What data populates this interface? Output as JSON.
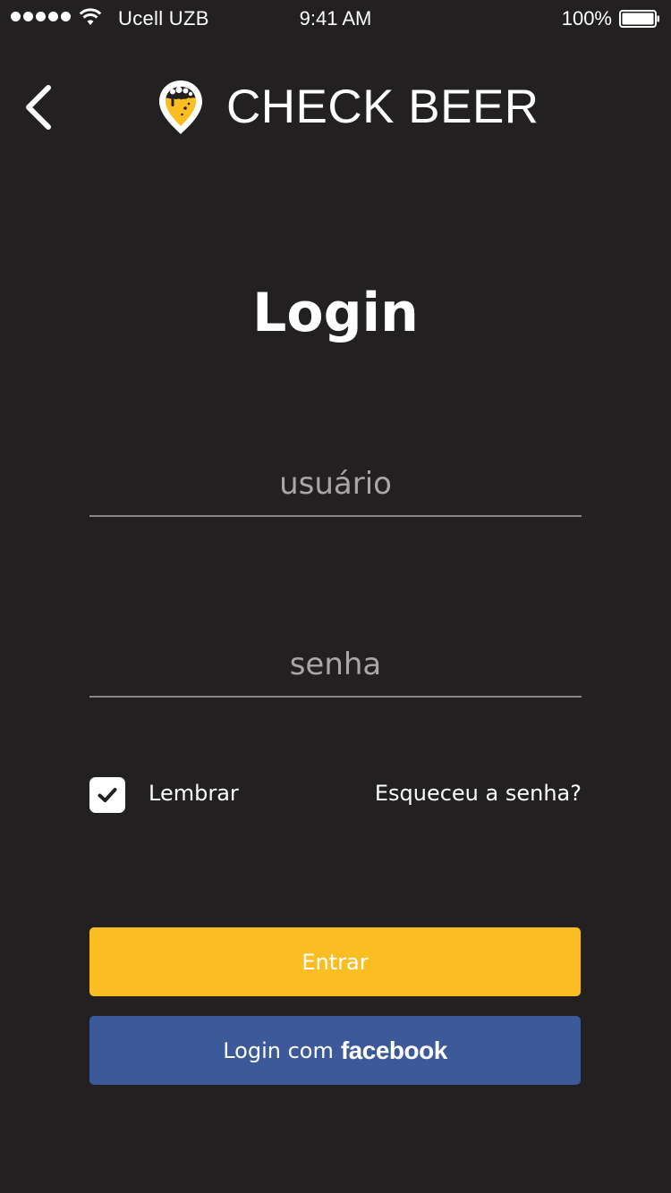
{
  "status_bar": {
    "carrier": "Ucell UZB",
    "time": "9:41 AM",
    "battery": "100%"
  },
  "header": {
    "back_icon": "chevron-left-icon",
    "logo_icon": "beer-map-pin-icon",
    "app_name": "CHECK BEER"
  },
  "page": {
    "title": "Login"
  },
  "form": {
    "username_placeholder": "usuário",
    "password_placeholder": "senha",
    "remember_label": "Lembrar",
    "remember_checked": true,
    "forgot_link": "Esqueceu a senha?"
  },
  "buttons": {
    "enter_label": "Entrar",
    "facebook_prefix": "Login com",
    "facebook_brand": "facebook"
  },
  "colors": {
    "background": "#232022",
    "accent_yellow": "#fbbe22",
    "facebook_blue": "#3c5a9a",
    "divider": "#8a8789"
  }
}
